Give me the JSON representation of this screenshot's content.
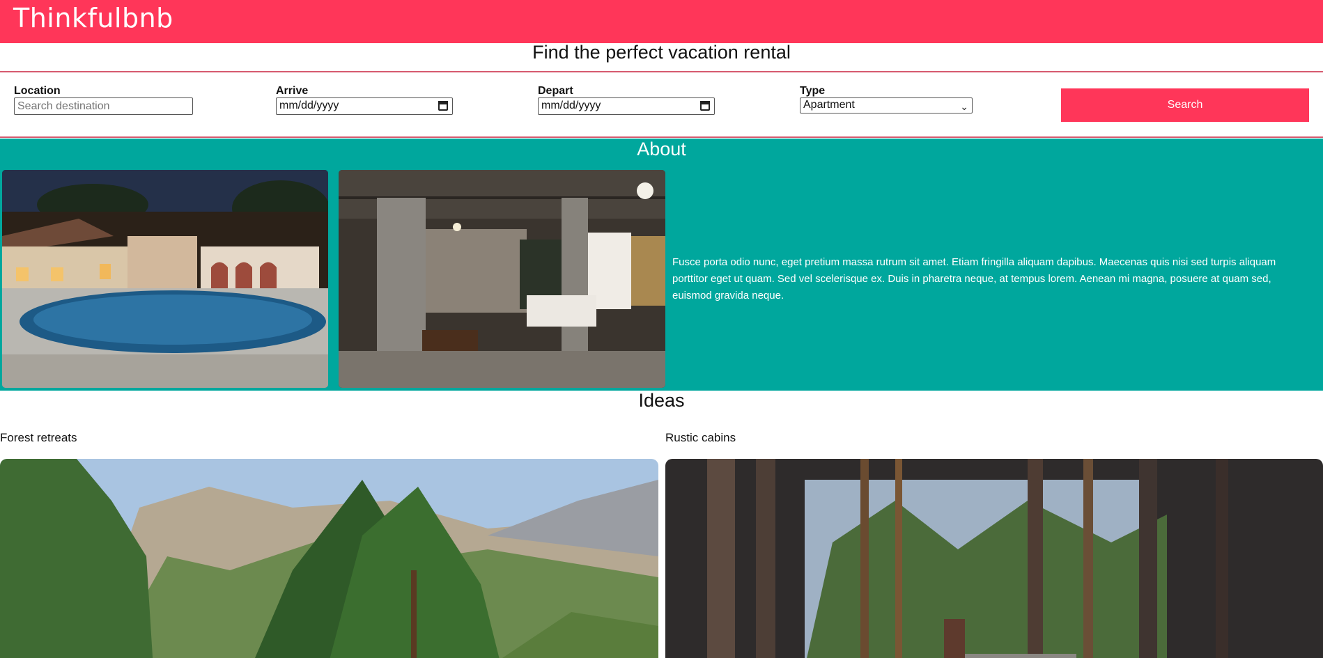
{
  "header": {
    "logo": "Thinkfulbnb"
  },
  "search": {
    "title": "Find the perfect vacation rental",
    "location": {
      "label": "Location",
      "placeholder": "Search destination",
      "value": ""
    },
    "arrive": {
      "label": "Arrive",
      "value": "mm/dd/yyyy"
    },
    "depart": {
      "label": "Depart",
      "value": "mm/dd/yyyy"
    },
    "type": {
      "label": "Type",
      "selected": "Apartment"
    },
    "button_label": "Search"
  },
  "about": {
    "title": "About",
    "text": "Fusce porta odio nunc, eget pretium massa rutrum sit amet. Etiam fringilla aliquam dapibus. Maecenas quis nisi sed turpis aliquam porttitor eget ut quam. Sed vel scelerisque ex. Duis in pharetra neque, at tempus lorem. Aenean mi magna, posuere at quam sed, euismod gravida neque."
  },
  "ideas": {
    "title": "Ideas",
    "cards": [
      {
        "label": "Forest retreats"
      },
      {
        "label": "Rustic cabins"
      }
    ]
  },
  "colors": {
    "brand": "#ff3659",
    "about_bg": "#00a79d"
  }
}
